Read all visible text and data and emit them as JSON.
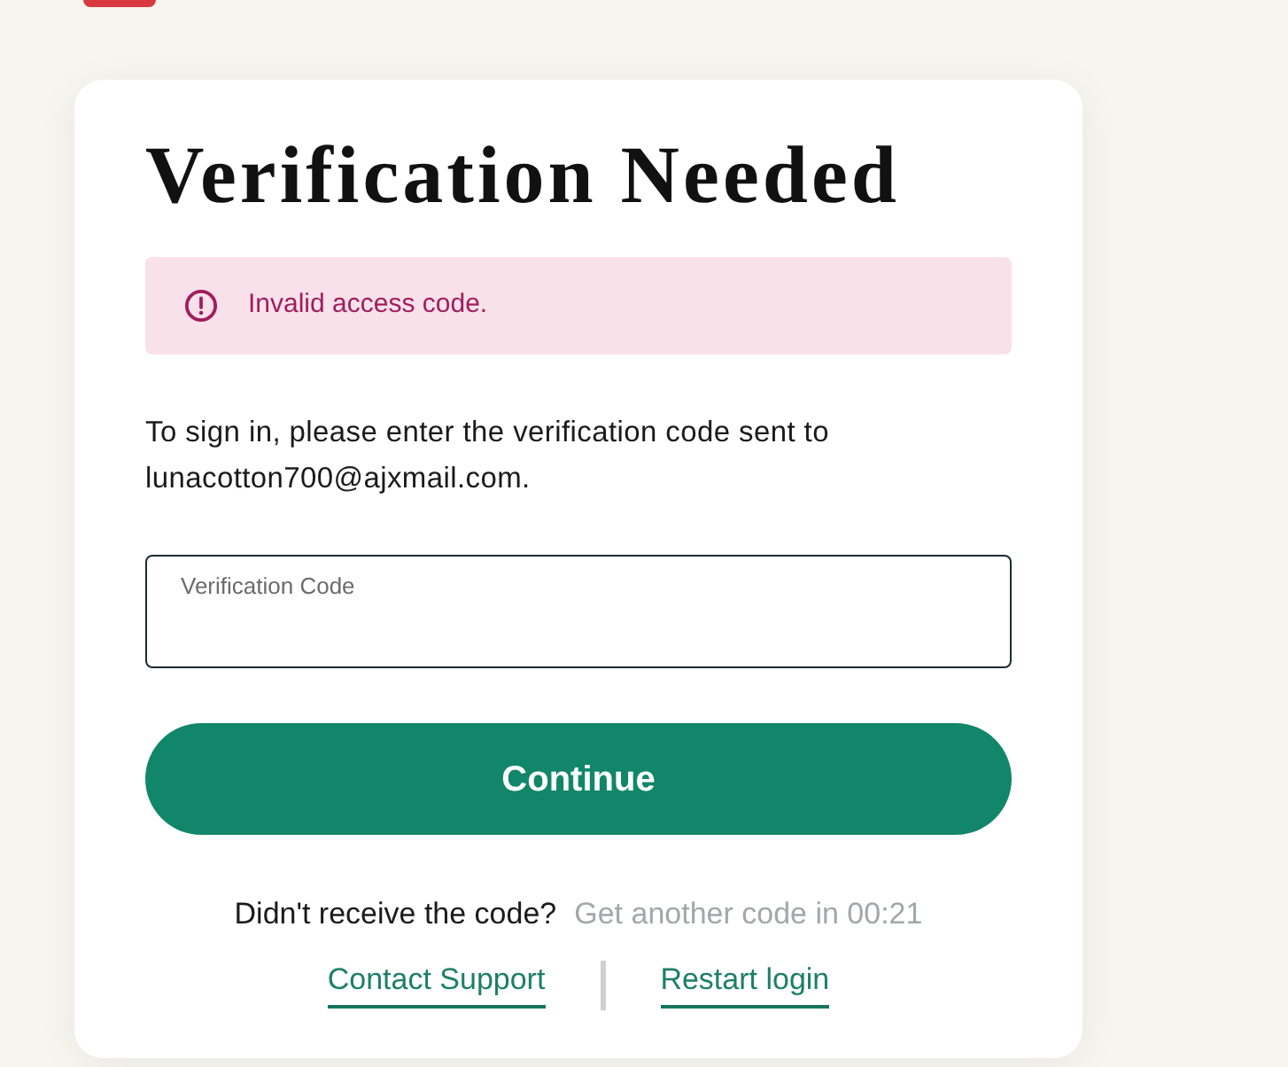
{
  "title": "Verification Needed",
  "alert": {
    "message": "Invalid access code."
  },
  "instructions": "To sign in, please enter the verification code sent to lunacotton700@ajxmail.com.",
  "code_field": {
    "label": "Verification Code"
  },
  "continue_button": "Continue",
  "resend": {
    "prompt": "Didn't receive the code?",
    "label": "Get another code in 00:21",
    "disabled": true
  },
  "links": [
    "Contact Support",
    "Restart login"
  ]
}
